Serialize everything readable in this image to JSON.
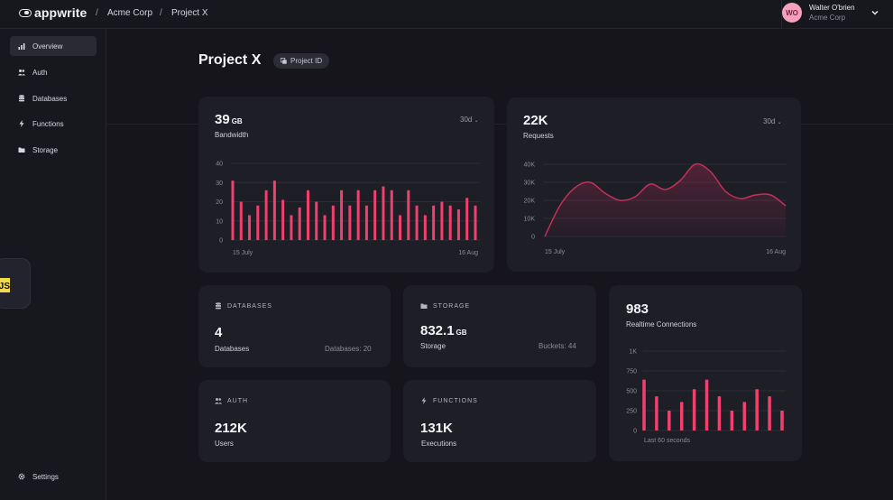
{
  "topbar": {
    "logo_text": "appwrite",
    "breadcrumb": [
      {
        "label": "Acme Corp"
      },
      {
        "label": "Project X"
      }
    ],
    "separator": "/",
    "user": {
      "initials": "WO",
      "name": "Walter O'brien",
      "org": "Acme Corp"
    }
  },
  "sidebar": {
    "items": [
      {
        "label": "Overview",
        "icon": "bar-chart-icon",
        "active": true
      },
      {
        "label": "Auth",
        "icon": "users-icon"
      },
      {
        "label": "Databases",
        "icon": "database-icon"
      },
      {
        "label": "Functions",
        "icon": "lightning-icon"
      },
      {
        "label": "Storage",
        "icon": "folder-icon"
      }
    ],
    "settings_label": "Settings",
    "js_badge": "JS"
  },
  "page": {
    "title": "Project X",
    "project_id_label": "Project ID"
  },
  "bandwidth": {
    "value": "39",
    "unit": "GB",
    "label": "Bandwidth",
    "period": "30d",
    "chart_data": {
      "type": "bar",
      "yticks": [
        "40",
        "30",
        "20",
        "10",
        "0"
      ],
      "ylim": [
        0,
        40
      ],
      "x_start_label": "15 July",
      "x_end_label": "16 Aug",
      "values": [
        31,
        20,
        13,
        18,
        26,
        31,
        21,
        13,
        17,
        26,
        20,
        13,
        18,
        26,
        18,
        26,
        18,
        26,
        28,
        26,
        13,
        26,
        18,
        13,
        18,
        20,
        18,
        16,
        22,
        18
      ],
      "color": "#f0406e"
    }
  },
  "requests": {
    "value": "22K",
    "label": "Requests",
    "period": "30d",
    "chart_data": {
      "type": "area",
      "yticks": [
        "40K",
        "30K",
        "20K",
        "10K",
        "0"
      ],
      "ylim": [
        0,
        40
      ],
      "x_start_label": "15 July",
      "x_end_label": "16 Aug",
      "points": [
        [
          0,
          0
        ],
        [
          1,
          17
        ],
        [
          2,
          27
        ],
        [
          3,
          30
        ],
        [
          4,
          24
        ],
        [
          5,
          20
        ],
        [
          6,
          22
        ],
        [
          7,
          29
        ],
        [
          8,
          26
        ],
        [
          9,
          31
        ],
        [
          10,
          40
        ],
        [
          11,
          36
        ],
        [
          12,
          25
        ],
        [
          13,
          21
        ],
        [
          14,
          23
        ],
        [
          15,
          23
        ],
        [
          16,
          17
        ]
      ],
      "color": "#c2305a"
    }
  },
  "databases": {
    "head": "DATABASES",
    "value": "4",
    "label": "Databases",
    "meta": "Databases: 20"
  },
  "storage": {
    "head": "STORAGE",
    "value": "832.1",
    "unit": "GB",
    "label": "Storage",
    "meta": "Buckets: 44"
  },
  "auth": {
    "head": "AUTH",
    "value": "212K",
    "label": "Users"
  },
  "functions": {
    "head": "FUNCTIONS",
    "value": "131K",
    "label": "Executions"
  },
  "realtime": {
    "value": "983",
    "label": "Realtime Connections",
    "chart_data": {
      "type": "bar",
      "yticks": [
        "1K",
        "750",
        "500",
        "250",
        "0"
      ],
      "ylim": [
        0,
        1000
      ],
      "x_caption": "Last 60 seconds",
      "values": [
        640,
        430,
        250,
        360,
        520,
        640,
        430,
        250,
        360,
        520,
        430,
        250
      ],
      "color": "#f0406e"
    }
  }
}
